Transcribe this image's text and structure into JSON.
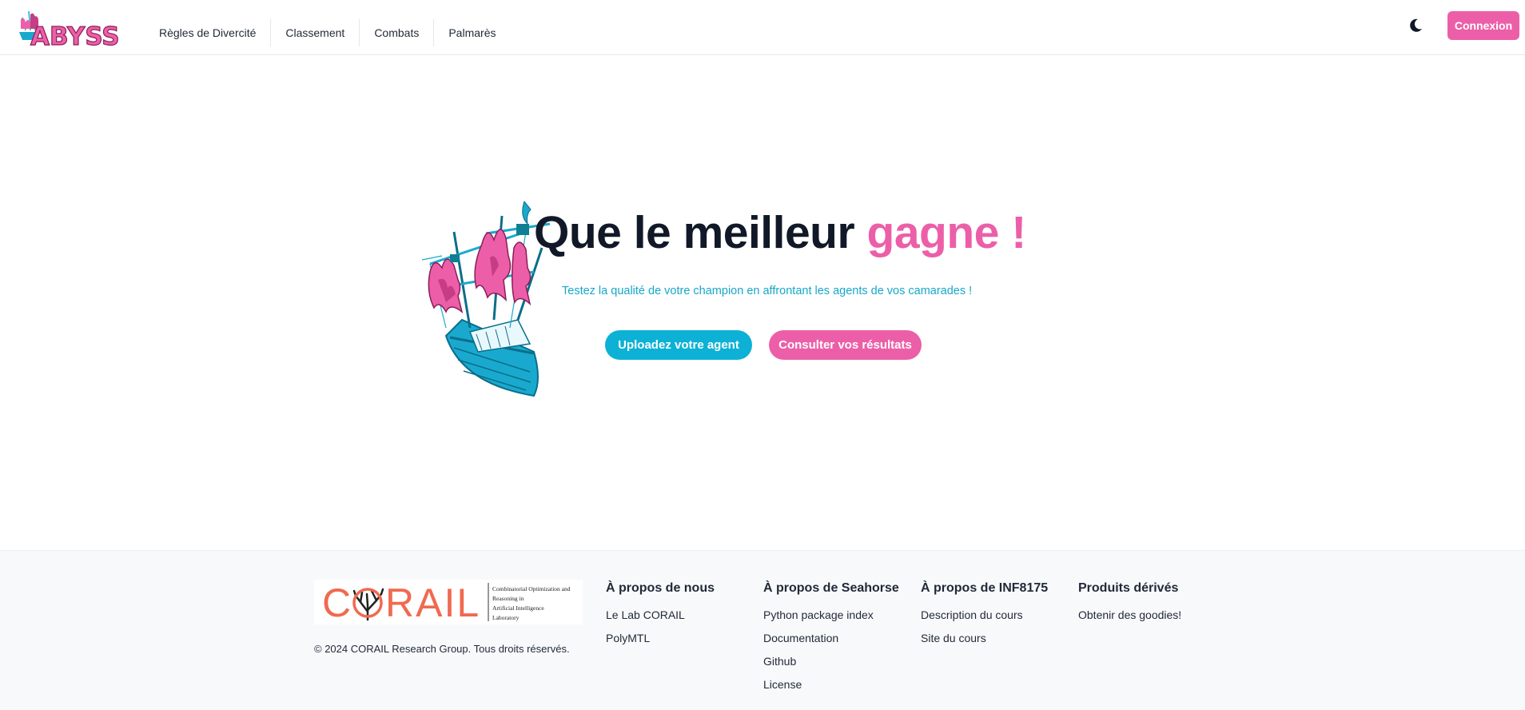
{
  "header": {
    "logo_text": "ABYSS",
    "nav": [
      {
        "label": "Règles de Divercité"
      },
      {
        "label": "Classement"
      },
      {
        "label": "Combats"
      },
      {
        "label": "Palmarès"
      }
    ],
    "theme_icon": "moon-icon",
    "login_label": "Connexion"
  },
  "hero": {
    "title_main": "Que le meilleur ",
    "title_accent": "gagne !",
    "subtitle": "Testez la qualité de votre champion en affrontant les agents de vos camarades !",
    "upload_label": "Uploadez votre agent",
    "results_label": "Consulter vos résultats"
  },
  "footer": {
    "corail_logo": {
      "word": "CORAIL",
      "lines": [
        "Combinatorial Optimization and",
        "Reasoning in",
        "Artificial Intelligence",
        "Laboratory"
      ]
    },
    "copyright": "© 2024 CORAIL Research Group. Tous droits réservés.",
    "columns": [
      {
        "title": "À propos de nous",
        "links": [
          "Le Lab CORAIL",
          "PolyMTL"
        ]
      },
      {
        "title": "À propos de Seahorse",
        "links": [
          "Python package index",
          "Documentation",
          "Github",
          "License"
        ]
      },
      {
        "title": "À propos de INF8175",
        "links": [
          "Description du cours",
          "Site du cours"
        ]
      },
      {
        "title": "Produits dérivés",
        "links": [
          "Obtenir des goodies!"
        ]
      }
    ]
  },
  "colors": {
    "pink": "#ec5fa8",
    "cyan": "#0db1d6",
    "dark": "#111827"
  }
}
